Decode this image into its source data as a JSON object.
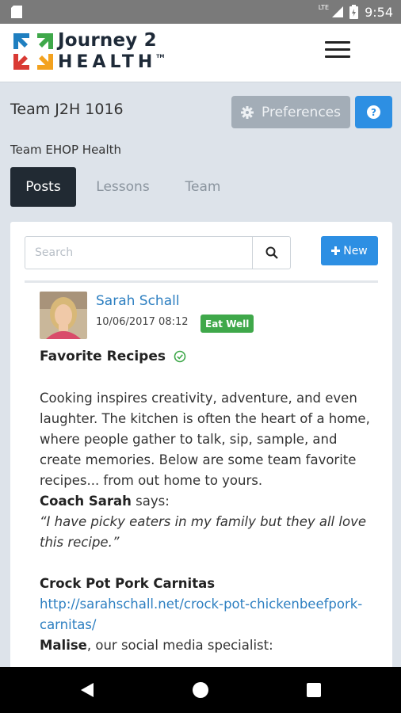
{
  "status_bar": {
    "network": "LTE",
    "time": "9:54"
  },
  "header": {
    "logo_line1": "Journey 2",
    "logo_line2": "HEALTH",
    "logo_tm": "TM",
    "menu_icon": "hamburger-icon"
  },
  "team": {
    "title": "Team J2H 1016",
    "subtitle": "Team EHOP Health",
    "preferences_label": "Preferences",
    "preferences_icon": "gear-icon",
    "help_label": "?"
  },
  "tabs": [
    {
      "label": "Posts",
      "active": true
    },
    {
      "label": "Lessons",
      "active": false
    },
    {
      "label": "Team",
      "active": false
    }
  ],
  "search": {
    "placeholder": "Search",
    "value": ""
  },
  "new_button": {
    "label": "New"
  },
  "post": {
    "author": "Sarah Schall",
    "date": "10/06/2017 08:12",
    "badge": "Eat Well",
    "badge_color": "#3fa84a",
    "title": "Favorite Recipes",
    "body_intro": "Cooking inspires creativity, adventure, and even laughter. The kitchen is often the heart of a home, where people gather to talk, sip, sample, and create memories. Below are some team favorite recipes... from out home to yours.",
    "coach_name": "Coach Sarah",
    "coach_says": " says:",
    "coach_quote": "“I have picky eaters in my family but they all love this recipe.”",
    "recipe_title": "Crock Pot Pork Carnitas",
    "recipe_link": "http://sarahschall.net/crock-pot-chickenbeefpork-carnitas/",
    "next_name": "Malise",
    "next_text": ", our social media specialist:"
  },
  "colors": {
    "accent": "#2d8fe3",
    "link": "#2d7fc1",
    "tab_active_bg": "#212a33",
    "page_bg": "#dde3ea"
  }
}
